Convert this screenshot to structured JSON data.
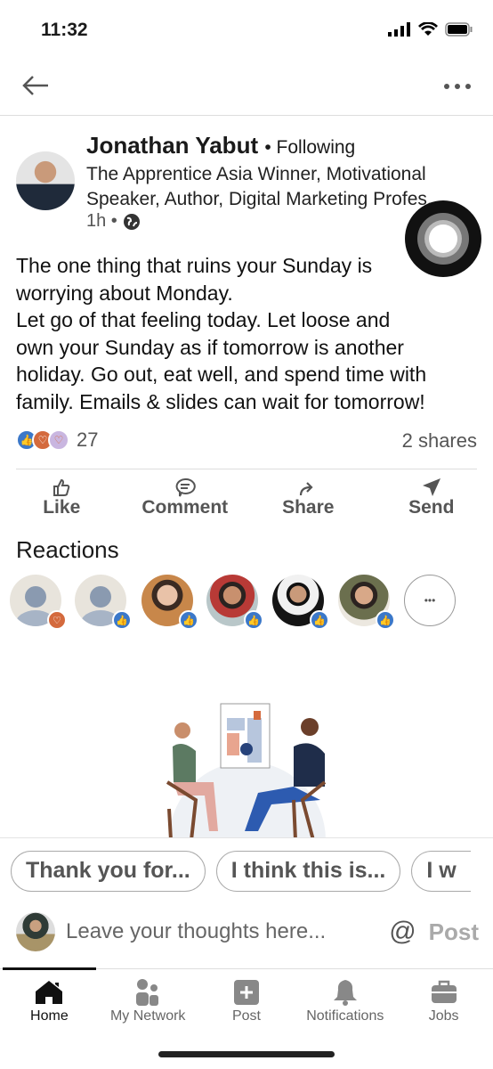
{
  "status_bar": {
    "time": "11:32"
  },
  "post": {
    "author": "Jonathan Yabut",
    "following": "• Following",
    "headline": "The Apprentice Asia Winner, Motivational Speaker, Author, Digital Marketing Profes...",
    "time": "1h •",
    "body": [
      "The one thing that ruins your Sunday is",
      "worrying about Monday.",
      "Let go of that feeling today. Let loose and",
      "own your Sunday as if tomorrow is another",
      "holiday. Go out, eat well, and spend time with",
      "family. Emails & slides can wait for tomorrow!"
    ],
    "reaction_count": "27",
    "shares": "2 shares"
  },
  "actions": [
    {
      "label": "Like",
      "icon": "like-icon"
    },
    {
      "label": "Comment",
      "icon": "comment-icon"
    },
    {
      "label": "Share",
      "icon": "share-icon"
    },
    {
      "label": "Send",
      "icon": "send-icon"
    }
  ],
  "reactions": {
    "heading": "Reactions",
    "people": [
      {
        "type": "love"
      },
      {
        "type": "like"
      },
      {
        "type": "like"
      },
      {
        "type": "like"
      },
      {
        "type": "like"
      },
      {
        "type": "like"
      }
    ],
    "more": "•••"
  },
  "suggestions": [
    "Thank you for...",
    "I think this is...",
    "I w"
  ],
  "comment": {
    "placeholder": "Leave your thoughts here...",
    "mention": "@",
    "post": "Post"
  },
  "tabs": [
    {
      "label": "Home",
      "active": true
    },
    {
      "label": "My Network"
    },
    {
      "label": "Post"
    },
    {
      "label": "Notifications"
    },
    {
      "label": "Jobs"
    }
  ],
  "colors": {
    "like": "#3b78c9",
    "love": "#d46a3d",
    "active_tab": "#111",
    "inactive_tab": "#666"
  }
}
